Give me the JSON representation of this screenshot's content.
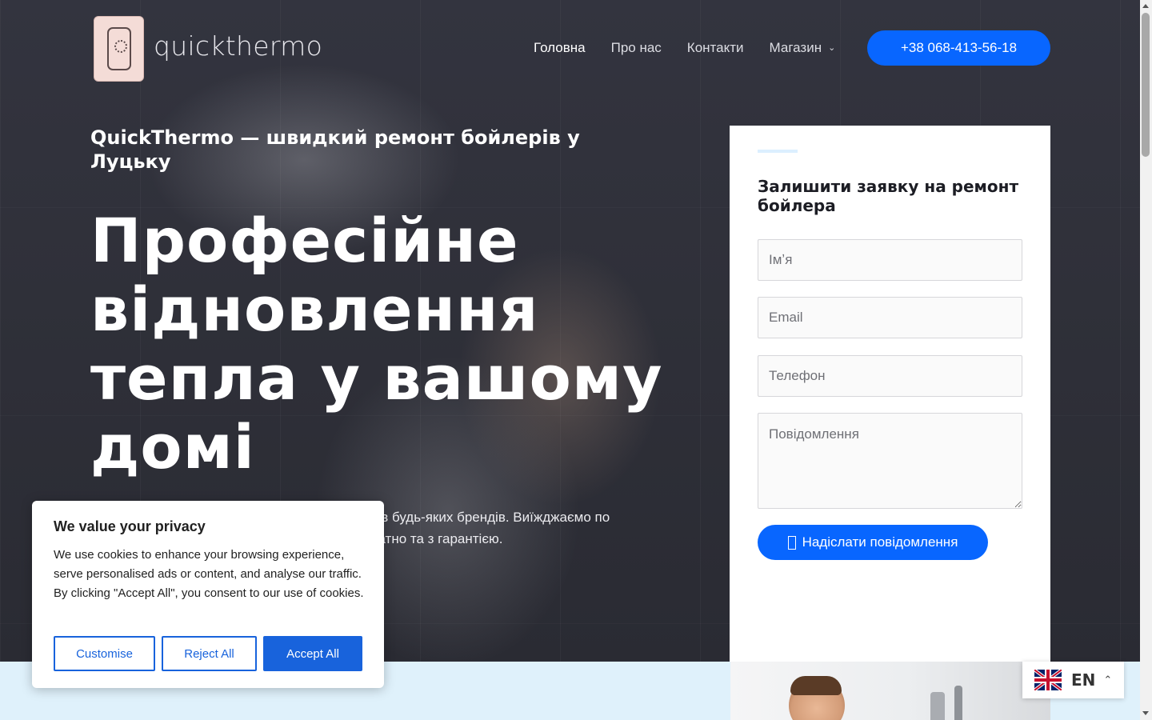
{
  "brand": {
    "name": "quickthermo"
  },
  "nav": {
    "items": [
      {
        "label": "Головна",
        "active": true
      },
      {
        "label": "Про нас",
        "active": false
      },
      {
        "label": "Контакти",
        "active": false
      },
      {
        "label": "Магазин",
        "active": false,
        "has_dropdown": true
      }
    ],
    "dropdown_icon": "chevron-down-icon"
  },
  "header": {
    "phone_button": "+38 068-413-56-18"
  },
  "hero": {
    "subtitle": "QuickThermo — швидкий ремонт бойлерів у Луцьку",
    "headline": "Професійне відновлення тепла у вашому домі",
    "desc_line1": "рів будь-яких брендів. Виїжджаємо по",
    "desc_line2": "ратно та з гарантією."
  },
  "form": {
    "title": "Залишити заявку на ремонт бойлера",
    "name_placeholder": "Імʼя",
    "email_placeholder": "Email",
    "phone_placeholder": "Телефон",
    "message_placeholder": "Повідомлення",
    "submit_label": "Надіслати повідомлення",
    "submit_icon": "send-icon"
  },
  "cookie": {
    "title": "We value your privacy",
    "text": "We use cookies to enhance your browsing experience, serve personalised ads or content, and analyse our traffic. By clicking \"Accept All\", you consent to our use of cookies.",
    "customise": "Customise",
    "reject": "Reject All",
    "accept": "Accept All"
  },
  "language": {
    "code": "EN",
    "flag_icon": "uk-flag-icon"
  },
  "colors": {
    "accent": "#0866ff",
    "cookie_accent": "#1863dc",
    "hero_bg": "#2f3039"
  }
}
